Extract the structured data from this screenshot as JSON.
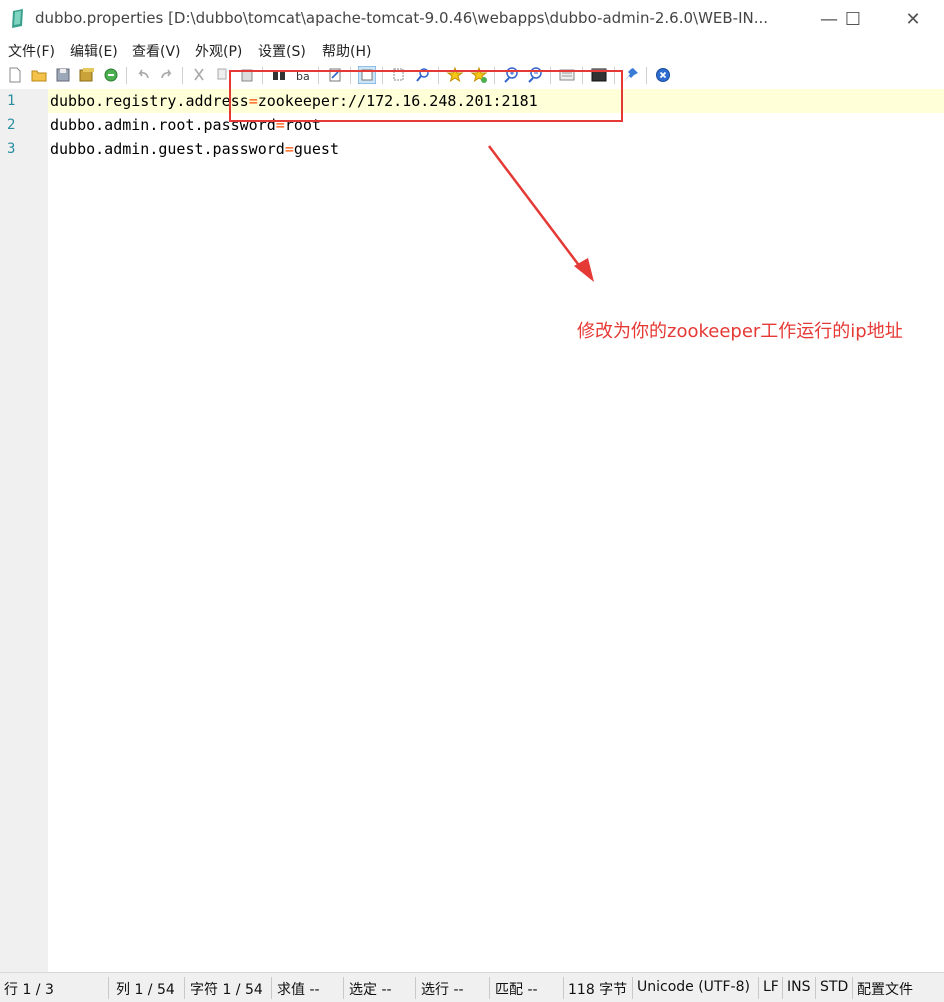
{
  "window": {
    "title": "dubbo.properties [D:\\dubbo\\tomcat\\apache-tomcat-9.0.46\\webapps\\dubbo-admin-2.6.0\\WEB-IN...",
    "minimize": "—",
    "maximize": "☐",
    "close": "✕"
  },
  "menu": [
    "文件(F)",
    "编辑(E)",
    "查看(V)",
    "外观(P)",
    "设置(S)",
    "帮助(H)"
  ],
  "toolbar_icons": [
    "new-file-icon",
    "open-icon",
    "save-icon",
    "save-all-icon",
    "revert-icon",
    "undo-icon",
    "redo-icon",
    "cut-icon",
    "copy-icon",
    "paste-icon",
    "find-icon",
    "replace-icon",
    "goto-icon",
    "word-wrap-icon",
    "select-icon",
    "find-next-icon",
    "favorite-icon",
    "add-favorite-icon",
    "zoom-in-icon",
    "zoom-out-icon",
    "scheme-icon",
    "console-icon",
    "pin-icon",
    "exit-icon"
  ],
  "editor": {
    "line_numbers": [
      "1",
      "2",
      "3"
    ],
    "lines": [
      {
        "key": "dubbo.registry.address",
        "eq": "=",
        "value": "zookeeper://172.16.248.201:2181"
      },
      {
        "key": "dubbo.admin.root.password",
        "eq": "=",
        "value": "root"
      },
      {
        "key": "dubbo.admin.guest.password",
        "eq": "=",
        "value": "guest"
      }
    ]
  },
  "annotation": {
    "text": "修改为你的zookeeper工作运行的ip地址",
    "color": "#e53935"
  },
  "status": {
    "line": "行 1 / 3",
    "col": "列 1 / 54",
    "char": "字符 1 / 54",
    "sum": "求值 --",
    "sel": "选定 --",
    "sel_lines": "选行 --",
    "match": "匹配 --",
    "bytes": "118 字节",
    "encoding": "Unicode (UTF-8)",
    "eol": "LF",
    "ins": "INS",
    "std": "STD",
    "scheme": "配置文件"
  }
}
